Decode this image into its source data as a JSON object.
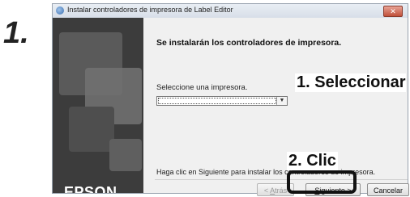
{
  "step_number": "1.",
  "window": {
    "title": "Instalar controladores de impresora de Label Editor",
    "close_symbol": "✕"
  },
  "sidebar": {
    "brand": "EPSON"
  },
  "content": {
    "header": "Se instalarán los controladores de impresora.",
    "select_label": "Seleccione una impresora.",
    "select_value": "",
    "hint": "Haga clic en Siguiente para instalar los controladores de impresora."
  },
  "buttons": {
    "back_prefix": "< ",
    "back_key": "A",
    "back_rest": "trás",
    "next_key": "S",
    "next_rest": "iguiente >",
    "cancel": "Cancelar"
  },
  "annotations": {
    "select": "1. Seleccionar",
    "click": "2. Clic"
  }
}
